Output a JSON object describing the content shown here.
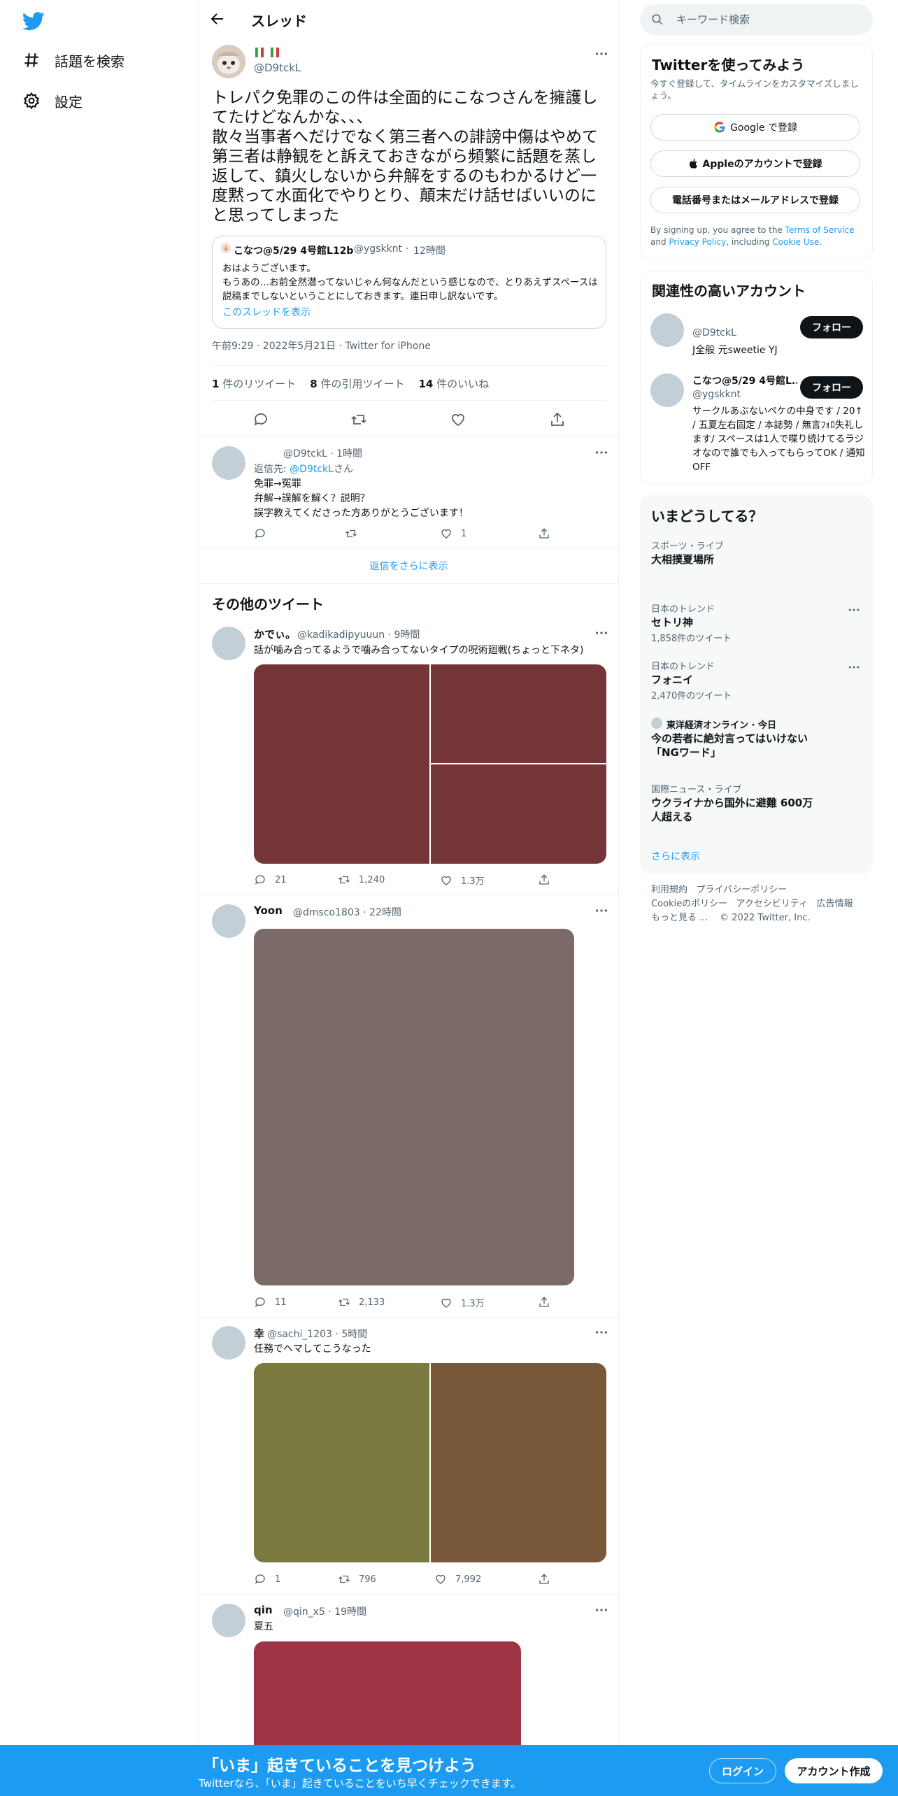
{
  "nav": {
    "explore_label": "話題を検索",
    "settings_label": "設定"
  },
  "header": {
    "title": "スレッド"
  },
  "main_tweet": {
    "handle": "@D9tckL",
    "text": "トレパク免罪のこの件は全面的にこなつさんを擁護してたけどなんかな、、、\n散々当事者へだけでなく第三者への誹謗中傷はやめて第三者は静観をと訴えておきながら頻繁に話題を蒸し返して、鎮火しないから弁解をするのもわかるけど一度黙って水面化でやりとり、顛末だけ話せばいいのにと思ってしまった",
    "quote": {
      "name": "こなつ@5/29 4号館L12b",
      "handle": "@ygskknt",
      "time": "12時間",
      "text": "おはようございます。\nもうあの…お前全然潜ってないじゃん何なんだという感じなので、とりあえずスペースは説稿までしないということにしておきます。連日申し訳ないです。",
      "show_thread": "このスレッドを表示"
    },
    "meta": "午前9:29 · 2022年5月21日 · Twitter for iPhone",
    "retweets_count": "1",
    "retweets_label": "件のリツイート",
    "quotes_count": "8",
    "quotes_label": "件の引用ツイート",
    "likes_count": "14",
    "likes_label": "件のいいね"
  },
  "reply": {
    "handle_time": "@D9tckL · 1時間",
    "reply_to_prefix": "返信先:",
    "reply_to_handle": "@D9tckL",
    "reply_to_suffix": "さん",
    "text": "免罪→冤罪\n弁解→誤解を解く？説明？\n誤字教えてくださった方ありがとうございます！",
    "likes": "1"
  },
  "show_more_replies": "返信をさらに表示",
  "other_tweets_title": "その他のツイート",
  "tweets": [
    {
      "name": "かでぃ。",
      "handle_time": "@kadikadipyuuun · 9時間",
      "text": "話が噛み合ってるようで噛み合ってないタイプの呪術廻戦(ちょっと下ネタ)",
      "replies": "21",
      "retweets": "1,240",
      "likes": "1.3万"
    },
    {
      "name": "Yoon",
      "handle_time": "@dmsco1803 · 22時間",
      "text": "",
      "replies": "11",
      "retweets": "2,133",
      "likes": "1.3万"
    },
    {
      "name": "幸",
      "handle_time": "@sachi_1203 · 5時間",
      "text": "任務でヘマしてこうなった",
      "replies": "1",
      "retweets": "796",
      "likes": "7,992"
    },
    {
      "name": "qin",
      "handle_time": "@qin_x5 · 19時間",
      "text": "夏五",
      "replies": "",
      "retweets": "",
      "likes": ""
    }
  ],
  "colors": {
    "img1_main": "#733537",
    "img2": "#7b6a67",
    "img3_left": "#7a7a3e",
    "img3_right": "#795739",
    "img4": "#9c3446",
    "accent": "#1d9bf0"
  },
  "search": {
    "placeholder": "キーワード検索"
  },
  "signup_card": {
    "title": "Twitterを使ってみよう",
    "subtitle": "今すぐ登録して、タイムラインをカスタマイズしましょう。",
    "google": "Google で登録",
    "apple": "Appleのアカウントで登録",
    "phone": "電話番号またはメールアドレスで登録",
    "terms_prefix": "By signing up, you agree to the",
    "terms_link": "Terms of Service",
    "terms_and": "and",
    "privacy_link": "Privacy Policy",
    "including": ", including",
    "cookie_link": "Cookie Use."
  },
  "related": {
    "title": "関連性の高いアカウント",
    "accounts": [
      {
        "name": "",
        "handle": "@D9tckL",
        "bio": "J全般 元sweetie YJ",
        "follow": "フォロー"
      },
      {
        "name": "こなつ@5/29 4号館L...",
        "handle": "@ygskknt",
        "bio": "サークルあぶないペケの中身です / 20↑ / 五夏左右固定 / 本誌勢 / 無言ﾌｫﾛ失礼します/ スペースは1人で喋り続けてるラジオなので誰でも入ってもらってOK / 通知OFF",
        "follow": "フォロー"
      }
    ]
  },
  "trends": {
    "title": "いまどうしてる？",
    "items": [
      {
        "category": "スポーツ・ライブ",
        "name": "大相撲夏場所",
        "count": ""
      },
      {
        "category": "日本のトレンド",
        "name": "セトリ神",
        "count": "1,858件のツイート"
      },
      {
        "category": "日本のトレンド",
        "name": "フォニイ",
        "count": "2,470件のツイート"
      },
      {
        "category": "東洋経済オンライン · 今日",
        "name": "今の若者に絶対言ってはいけない「NGワード」",
        "count": ""
      },
      {
        "category": "国際ニュース・ライブ",
        "name": "ウクライナから国外に避難 600万人超える",
        "count": ""
      }
    ],
    "show_more": "さらに表示"
  },
  "footer": {
    "terms": "利用規約",
    "privacy": "プライバシーポリシー",
    "cookie": "Cookieのポリシー",
    "accessibility": "アクセシビリティ",
    "ads": "広告情報",
    "more": "もっと見る ...",
    "copyright": "© 2022 Twitter, Inc."
  },
  "bottom_bar": {
    "title": "「いま」起きていることを見つけよう",
    "subtitle": "Twitterなら、「いま」起きていることをいち早くチェックできます。",
    "login": "ログイン",
    "signup": "アカウント作成"
  }
}
